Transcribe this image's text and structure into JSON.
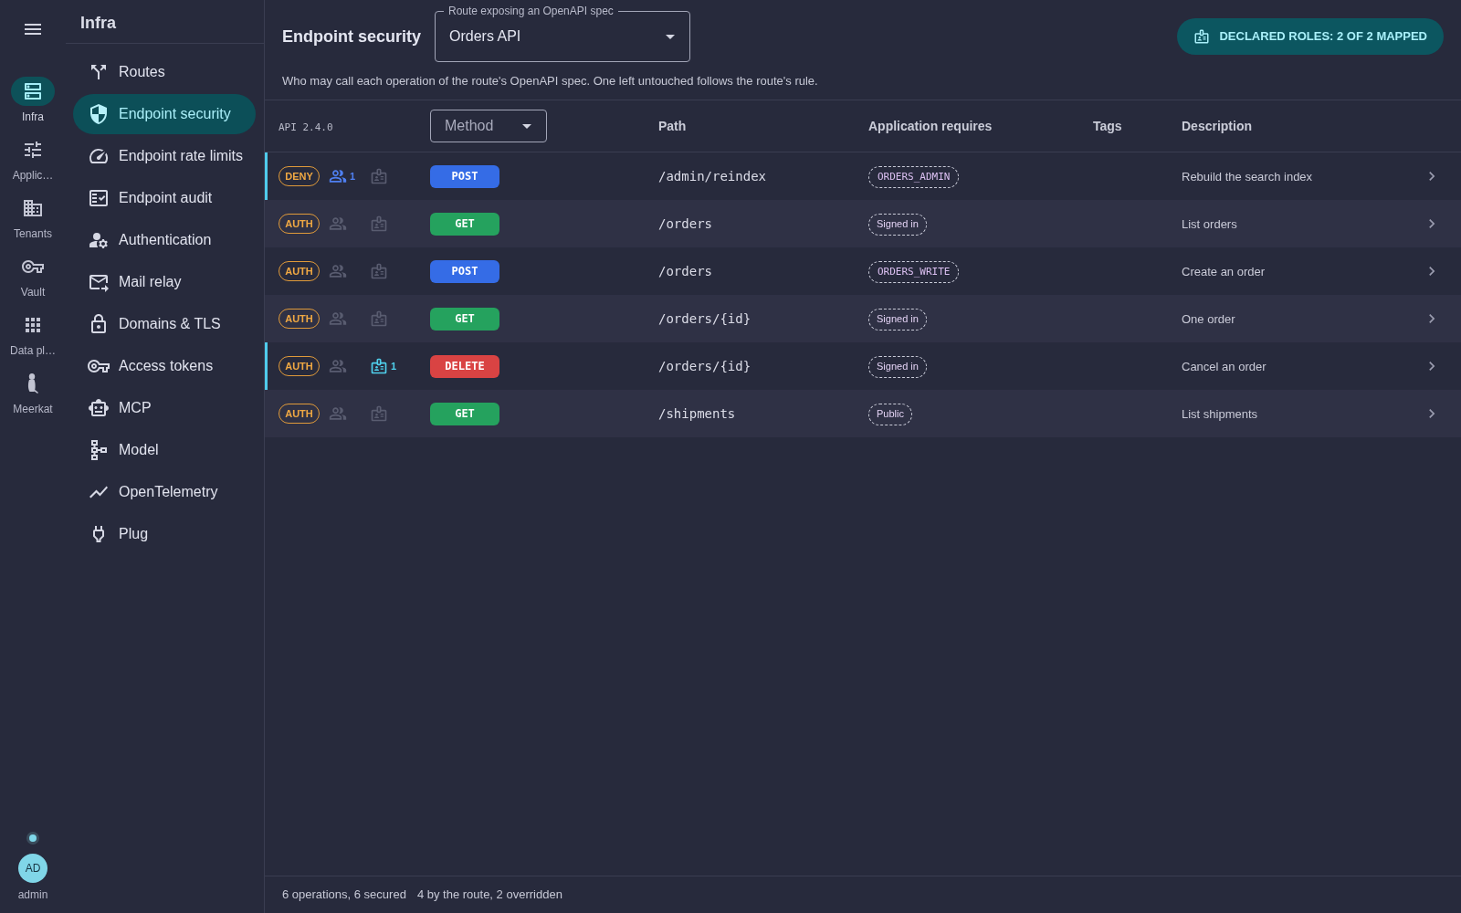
{
  "rail": {
    "items": [
      {
        "label": "Infra",
        "selected": true
      },
      {
        "label": "Applic…",
        "selected": false
      },
      {
        "label": "Tenants",
        "selected": false
      },
      {
        "label": "Vault",
        "selected": false
      },
      {
        "label": "Data pl…",
        "selected": false
      },
      {
        "label": "Meerkat",
        "selected": false
      }
    ],
    "user": {
      "initials": "AD",
      "name": "admin"
    }
  },
  "sidebar": {
    "title": "Infra",
    "items": [
      {
        "label": "Routes",
        "selected": false
      },
      {
        "label": "Endpoint security",
        "selected": true
      },
      {
        "label": "Endpoint rate limits",
        "selected": false
      },
      {
        "label": "Endpoint audit",
        "selected": false
      },
      {
        "label": "Authentication",
        "selected": false
      },
      {
        "label": "Mail relay",
        "selected": false
      },
      {
        "label": "Domains & TLS",
        "selected": false
      },
      {
        "label": "Access tokens",
        "selected": false
      },
      {
        "label": "MCP",
        "selected": false
      },
      {
        "label": "Model",
        "selected": false
      },
      {
        "label": "OpenTelemetry",
        "selected": false
      },
      {
        "label": "Plug",
        "selected": false
      }
    ]
  },
  "header": {
    "title": "Endpoint security",
    "route_select": {
      "label": "Route exposing an OpenAPI spec",
      "value": "Orders API"
    },
    "roles_button": "DECLARED ROLES: 2 OF 2 MAPPED",
    "description": "Who may call each operation of the route's OpenAPI spec. One left untouched follows the route's rule."
  },
  "table": {
    "api_version": "API 2.4.0",
    "method_filter": {
      "placeholder": "Method"
    },
    "columns": [
      "Path",
      "Application requires",
      "Tags",
      "Description"
    ],
    "rows": [
      {
        "overridden": true,
        "policy": "DENY",
        "users": {
          "active": true,
          "count": "1"
        },
        "roles": {
          "active": false
        },
        "method": {
          "label": "POST",
          "color": "#356ce6"
        },
        "path": "/admin/reindex",
        "requires": {
          "kind": "role",
          "label": "ORDERS_ADMIN"
        },
        "description": "Rebuild the search index"
      },
      {
        "overridden": false,
        "policy": "AUTH",
        "users": {
          "active": false
        },
        "roles": {
          "active": false
        },
        "method": {
          "label": "GET",
          "color": "#25a25e"
        },
        "path": "/orders",
        "requires": {
          "kind": "state",
          "label": "Signed in"
        },
        "description": "List orders"
      },
      {
        "overridden": false,
        "policy": "AUTH",
        "users": {
          "active": false
        },
        "roles": {
          "active": false
        },
        "method": {
          "label": "POST",
          "color": "#356ce6"
        },
        "path": "/orders",
        "requires": {
          "kind": "role",
          "label": "ORDERS_WRITE"
        },
        "description": "Create an order"
      },
      {
        "overridden": false,
        "policy": "AUTH",
        "users": {
          "active": false
        },
        "roles": {
          "active": false
        },
        "method": {
          "label": "GET",
          "color": "#25a25e"
        },
        "path": "/orders/{id}",
        "requires": {
          "kind": "state",
          "label": "Signed in"
        },
        "description": "One order"
      },
      {
        "overridden": true,
        "policy": "AUTH",
        "users": {
          "active": false
        },
        "roles": {
          "active": true,
          "count": "1"
        },
        "method": {
          "label": "DELETE",
          "color": "#d94343"
        },
        "path": "/orders/{id}",
        "requires": {
          "kind": "state",
          "label": "Signed in"
        },
        "description": "Cancel an order"
      },
      {
        "overridden": false,
        "policy": "AUTH",
        "users": {
          "active": false
        },
        "roles": {
          "active": false
        },
        "method": {
          "label": "GET",
          "color": "#25a25e"
        },
        "path": "/shipments",
        "requires": {
          "kind": "state",
          "label": "Public"
        },
        "description": "List shipments"
      }
    ]
  },
  "status_bar": {
    "summary": "6 operations, 6 secured",
    "detail": "4 by the route, 2 overridden"
  }
}
